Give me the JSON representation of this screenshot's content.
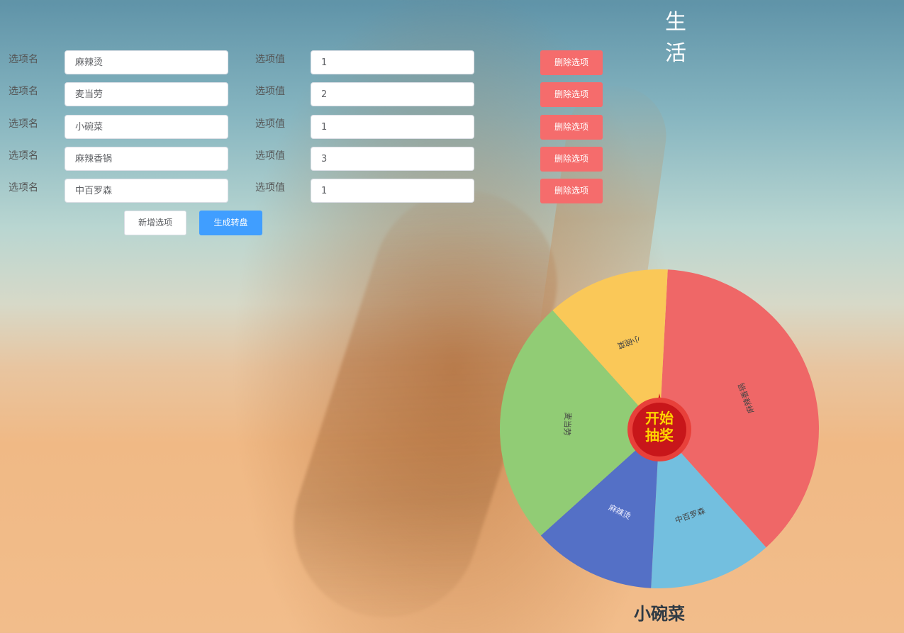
{
  "page_title": "生　活",
  "form": {
    "name_label": "选项名",
    "value_label": "选项值",
    "delete_label": "删除选项",
    "rows": [
      {
        "name": "麻辣烫",
        "value": "1"
      },
      {
        "name": "麦当劳",
        "value": "2"
      },
      {
        "name": "小碗菜",
        "value": "1"
      },
      {
        "name": "麻辣香锅",
        "value": "3"
      },
      {
        "name": "中百罗森",
        "value": "1"
      }
    ],
    "add_label": "新增选项",
    "generate_label": "生成转盘"
  },
  "wheel": {
    "slices": [
      {
        "name": "麻辣香锅",
        "weight": 3,
        "color": "#ef6767"
      },
      {
        "name": "中百罗森",
        "weight": 1,
        "color": "#73bfdf"
      },
      {
        "name": "麻辣烫",
        "weight": 1,
        "color": "#5470c6"
      },
      {
        "name": "麦当劳",
        "weight": 2,
        "color": "#91cc75"
      },
      {
        "name": "小碗菜",
        "weight": 1,
        "color": "#fac858"
      }
    ],
    "start_line1": "开始",
    "start_line2": "抽奖"
  },
  "result": "小碗菜"
}
